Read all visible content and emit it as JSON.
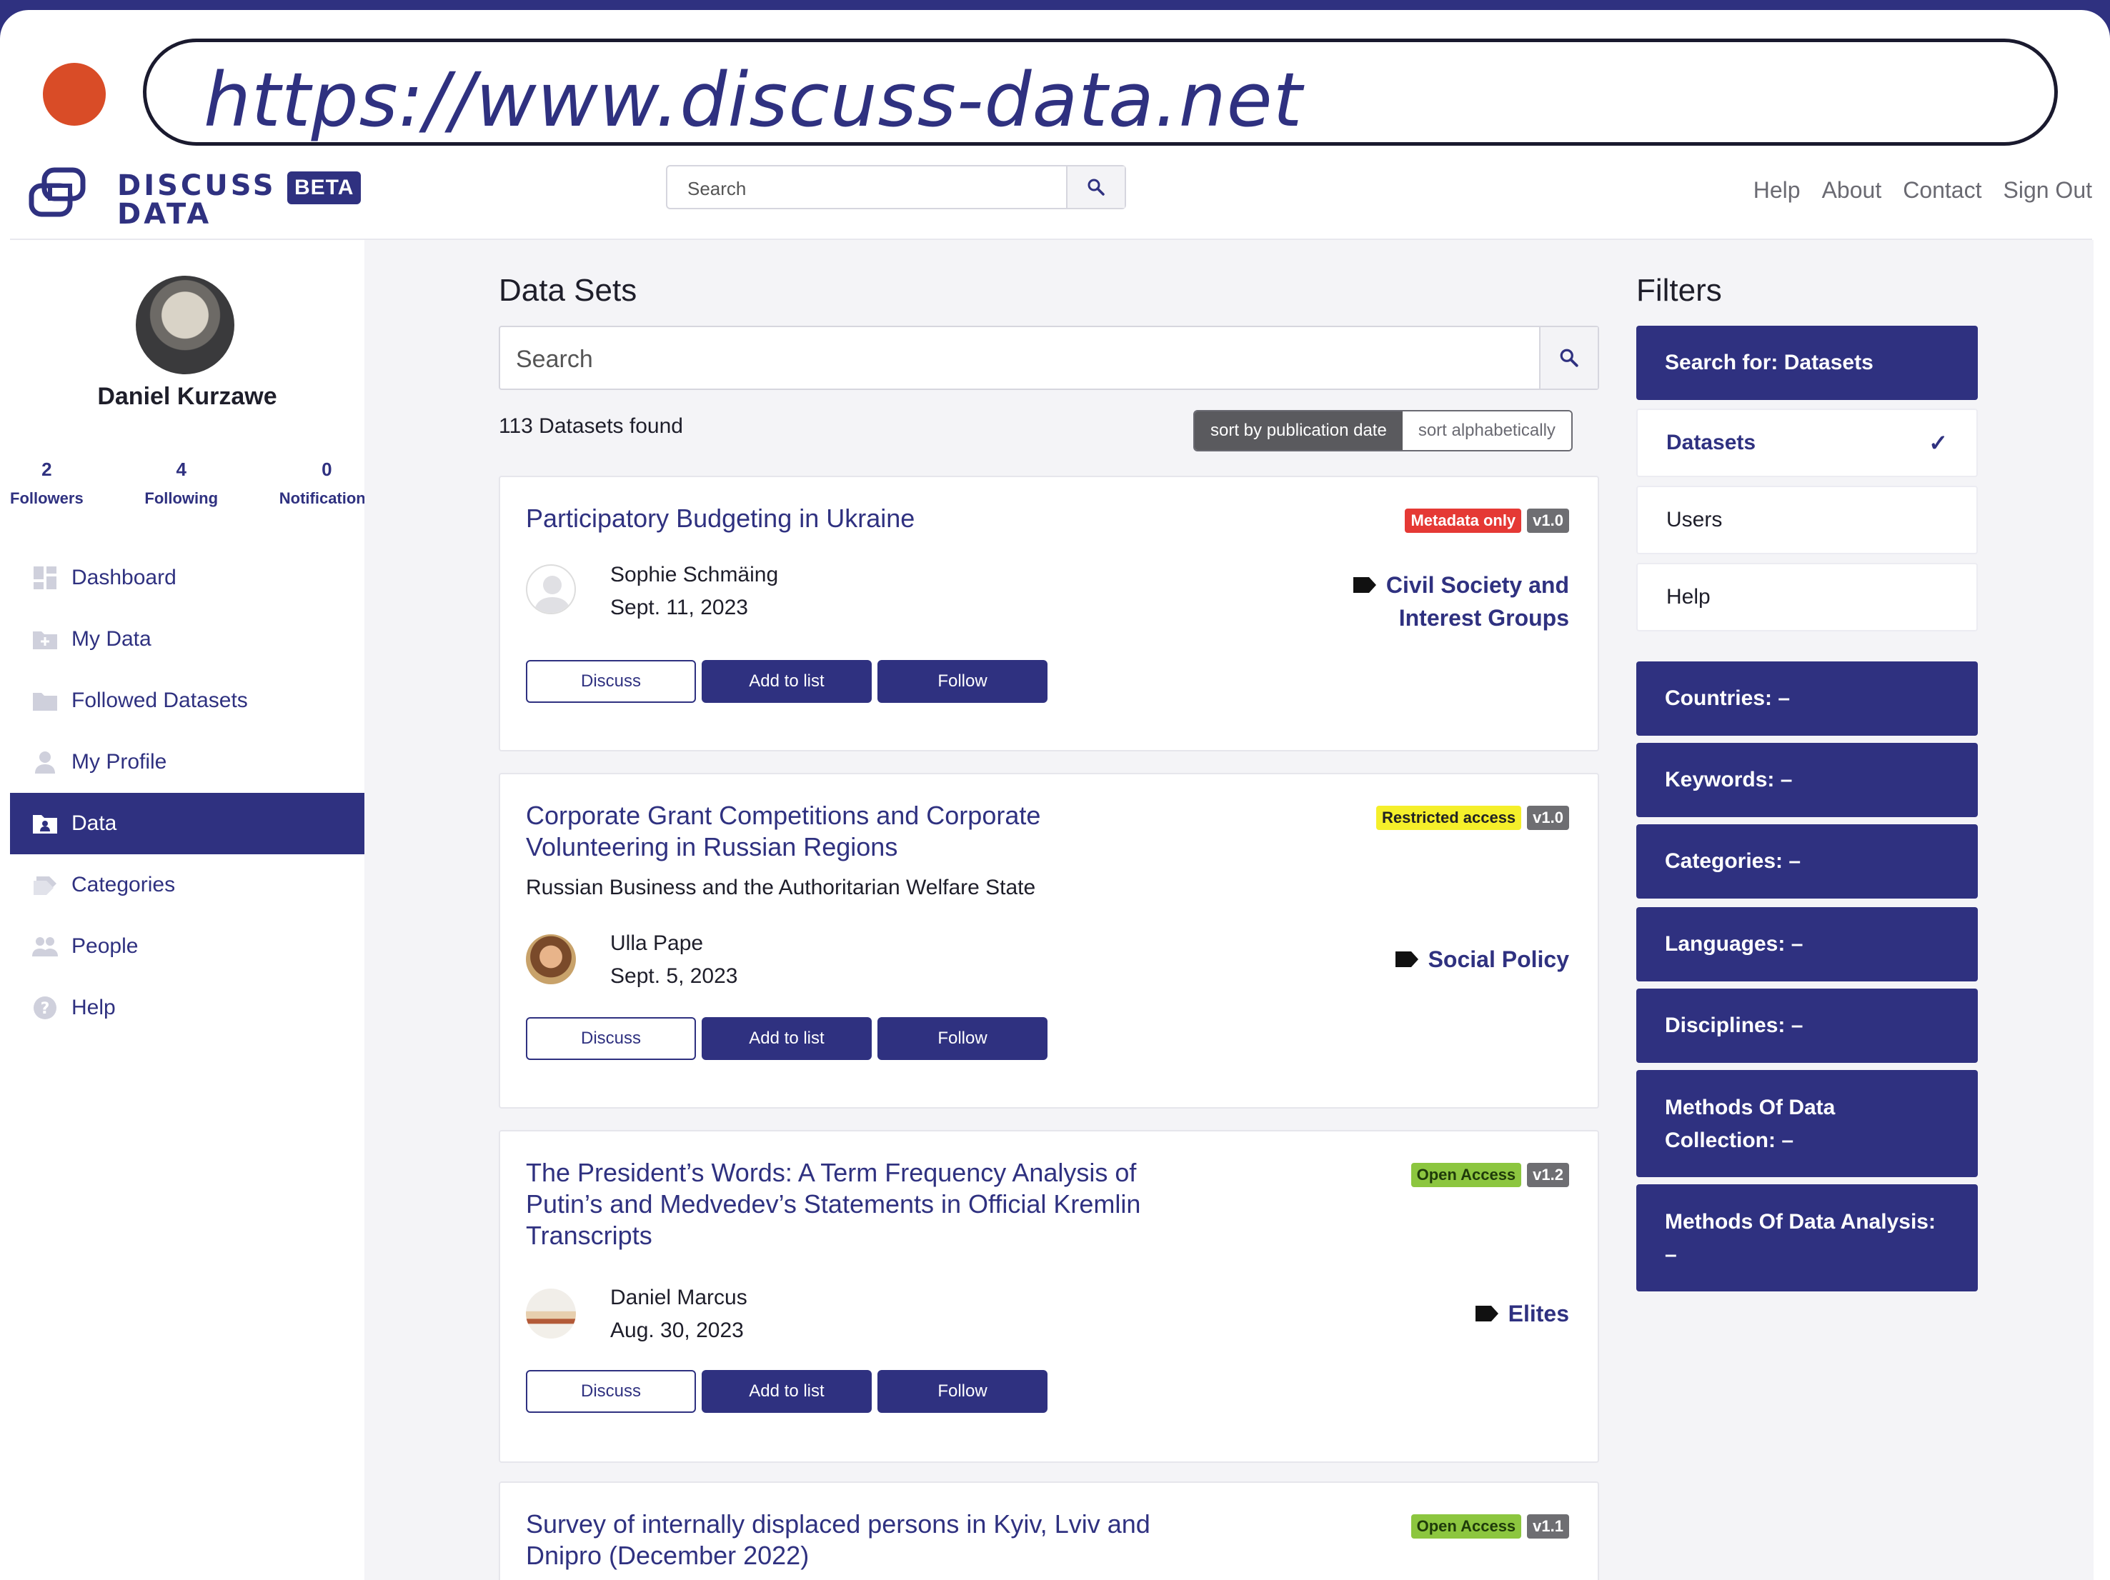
{
  "banner": {
    "url": "https://www.discuss-data.net"
  },
  "header": {
    "logo_line1": "DISCUSS",
    "logo_line2": "DATA",
    "beta": "BETA",
    "search_placeholder": "Search",
    "nav": [
      "Help",
      "About",
      "Contact",
      "Sign Out"
    ]
  },
  "sidebar": {
    "user_name": "Daniel Kurzawe",
    "stats": [
      {
        "value": "2",
        "label": "Followers"
      },
      {
        "value": "4",
        "label": "Following"
      },
      {
        "value": "0",
        "label": "Notifications"
      }
    ],
    "items": [
      {
        "label": "Dashboard",
        "icon": "dashboard-icon"
      },
      {
        "label": "My Data",
        "icon": "folder-plus-icon"
      },
      {
        "label": "Followed Datasets",
        "icon": "folder-icon"
      },
      {
        "label": "My Profile",
        "icon": "person-icon"
      },
      {
        "label": "Data",
        "icon": "id-card-icon",
        "active": true
      },
      {
        "label": "Categories",
        "icon": "categories-icon"
      },
      {
        "label": "People",
        "icon": "people-icon"
      },
      {
        "label": "Help",
        "icon": "question-icon"
      }
    ]
  },
  "main": {
    "title": "Data Sets",
    "search_placeholder": "Search",
    "found": "113 Datasets found",
    "sort": {
      "active": "sort by publication date",
      "inactive": "sort alphabetically"
    },
    "actions": {
      "discuss": "Discuss",
      "add": "Add to list",
      "follow": "Follow"
    },
    "datasets": [
      {
        "title": "Participatory Budgeting in Ukraine",
        "access": "Metadata only",
        "version": "v1.0",
        "author": "Sophie Schmäing",
        "date": "Sept. 11, 2023",
        "category_line1": "Civil Society and",
        "category_line2": "Interest Groups"
      },
      {
        "title_line1": "Corporate Grant Competitions and Corporate",
        "title_line2": "Volunteering in Russian Regions",
        "subtitle": "Russian Business and the Authoritarian Welfare State",
        "access": "Restricted access",
        "version": "v1.0",
        "author": "Ulla Pape",
        "date": "Sept. 5, 2023",
        "category": "Social Policy"
      },
      {
        "title_line1": "The President’s Words: A Term Frequency Analysis of",
        "title_line2": "Putin’s and Medvedev’s Statements in Official Kremlin",
        "title_line3": "Transcripts",
        "access": "Open Access",
        "version": "v1.2",
        "author": "Daniel Marcus",
        "date": "Aug. 30, 2023",
        "category": "Elites"
      },
      {
        "title_line1": "Survey of internally displaced persons in Kyiv, Lviv and",
        "title_line2": "Dnipro (December 2022)",
        "access": "Open Access",
        "version": "v1.1"
      }
    ]
  },
  "filters": {
    "title": "Filters",
    "search_for": "Search for: Datasets",
    "types": [
      "Datasets",
      "Users",
      "Help"
    ],
    "facets": [
      "Countries: –",
      "Keywords: –",
      "Categories: –",
      "Languages: –",
      "Disciplines: –"
    ],
    "methods_collection_line1": "Methods Of Data",
    "methods_collection_line2": "Collection: –",
    "methods_analysis_line1": "Methods Of Data Analysis:",
    "methods_analysis_line2": "–"
  }
}
